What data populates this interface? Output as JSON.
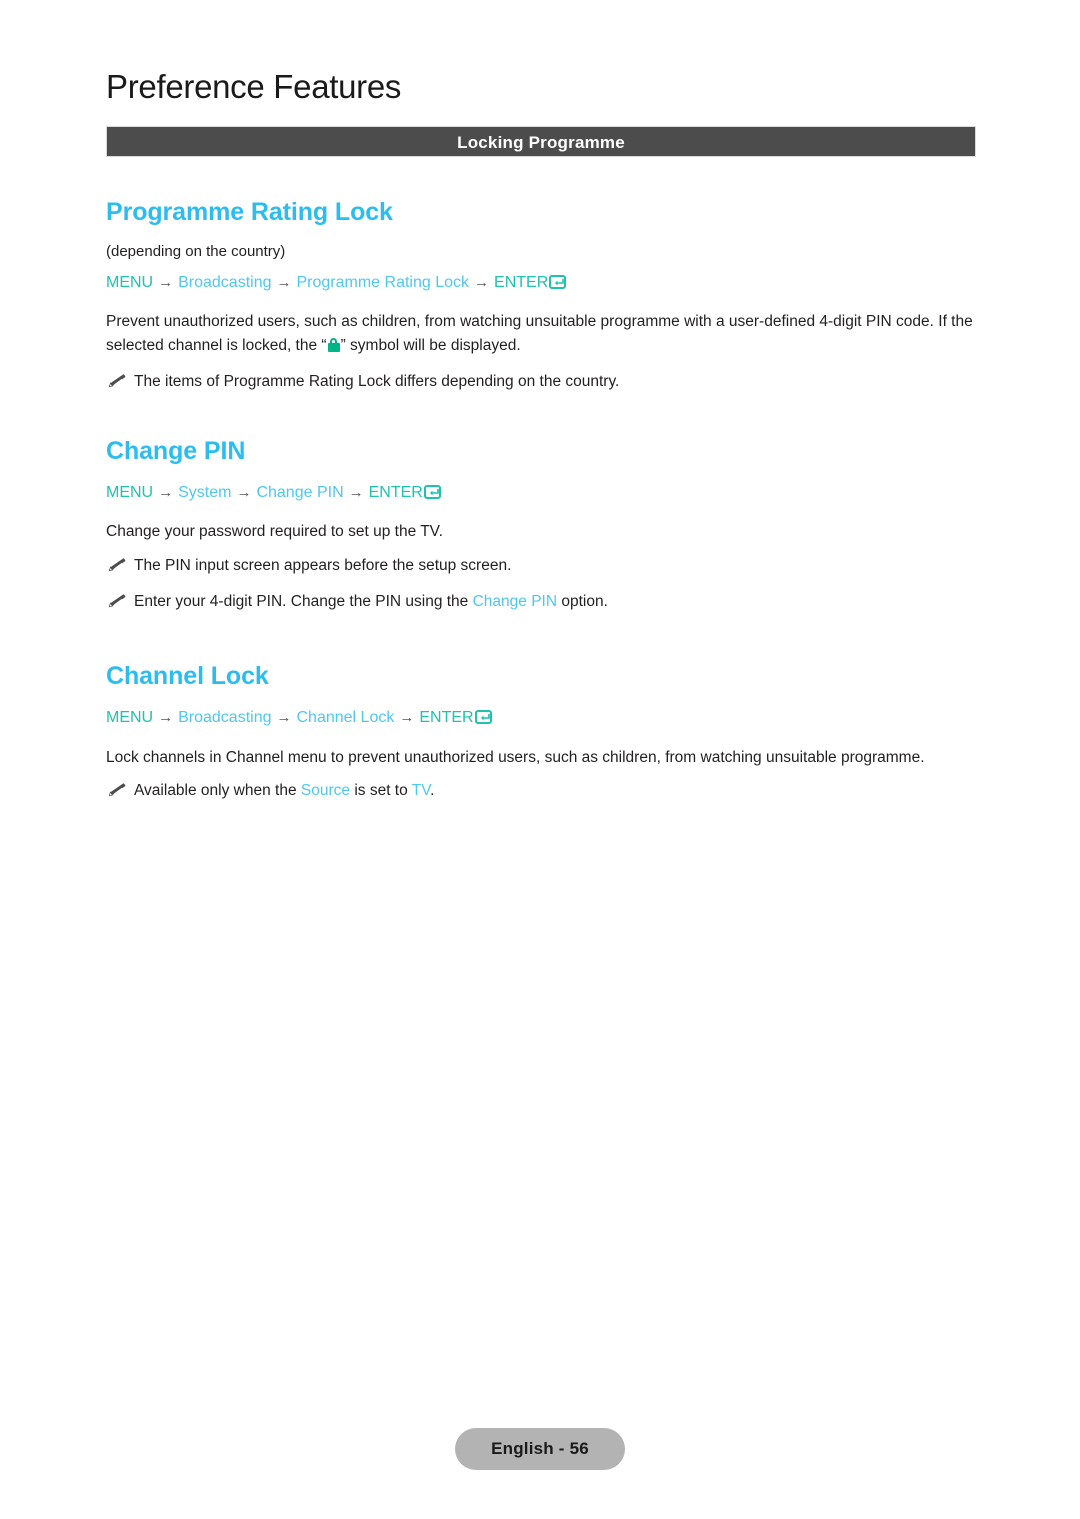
{
  "page": {
    "title": "Preference Features",
    "section_bar": "Locking Programme",
    "footer": "English - 56"
  },
  "sections": [
    {
      "heading": "Programme Rating Lock",
      "subnote": "(depending on the country)",
      "menu_path": {
        "menu": "MENU",
        "arrow": "→",
        "step1": "Broadcasting",
        "step2": "Programme Rating Lock",
        "enter": "ENTER"
      },
      "body_part1": "Prevent unauthorized users, such as children, from watching unsuitable programme with a user-defined 4-digit PIN code. If the selected channel is locked, the “",
      "body_part2": "” symbol will be displayed.",
      "notes": [
        {
          "text": "The items of Programme Rating Lock differs depending on the country."
        }
      ]
    },
    {
      "heading": "Change PIN",
      "menu_path": {
        "menu": "MENU",
        "arrow": "→",
        "step1": "System",
        "step2": "Change PIN",
        "enter": "ENTER"
      },
      "body": "Change your password required to set up the TV.",
      "notes": [
        {
          "text": "The PIN input screen appears before the setup screen."
        },
        {
          "pre": "Enter your 4-digit PIN. Change the PIN using the ",
          "link": "Change PIN",
          "post": " option."
        }
      ]
    },
    {
      "heading": "Channel Lock",
      "menu_path": {
        "menu": "MENU",
        "arrow": "→",
        "step1": "Broadcasting",
        "step2": "Channel Lock",
        "enter": "ENTER"
      },
      "body": "Lock channels in Channel menu to prevent unauthorized users, such as children, from watching unsuitable programme.",
      "notes": [
        {
          "pre": "Available only when the ",
          "link": "Source",
          "mid": " is set to ",
          "link2": "TV",
          "post": "."
        }
      ]
    }
  ],
  "colors": {
    "heading_blue": "#2cbdf0",
    "menu_teal": "#1fc2ad",
    "menu_blue": "#4ec8f0",
    "bar_gray": "#4c4c4c",
    "footer_gray": "#b3b3b3",
    "lock_green": "#00b388"
  }
}
